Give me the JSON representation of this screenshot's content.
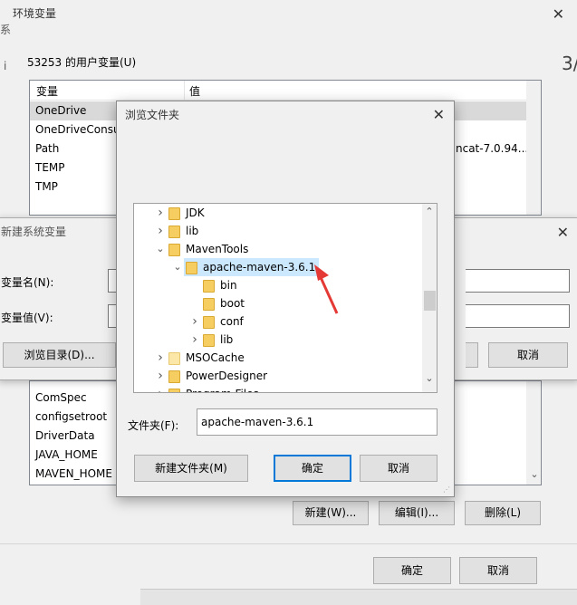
{
  "env_window": {
    "title": "环境变量",
    "user_vars_label": "53253 的用户变量(U)",
    "col_variable": "变量",
    "col_value": "值",
    "user_vars": [
      {
        "name": "OneDrive",
        "value": ""
      },
      {
        "name": "OneDriveConsu",
        "value": ""
      },
      {
        "name": "Path",
        "value": "ncat-7.0.94..."
      },
      {
        "name": "TEMP",
        "value": ""
      },
      {
        "name": "TMP",
        "value": ""
      }
    ],
    "system_vars": [
      "ComSpec",
      "configsetroot",
      "DriverData",
      "JAVA_HOME",
      "MAVEN_HOME"
    ],
    "new_button": "新建(W)...",
    "edit_button": "编辑(I)...",
    "delete_button": "删除(L)",
    "ok_button": "确定",
    "cancel_button": "取消",
    "edge_text_left": "系",
    "edge_text_i": "i",
    "edge_text_right": "3/"
  },
  "new_var_dialog": {
    "title": "新建系统变量",
    "name_label": "变量名(N):",
    "value_label": "变量值(V):",
    "browse_dir_button": "浏览目录(D)...",
    "cancel_button": "取消"
  },
  "browse_dialog": {
    "title": "浏览文件夹",
    "tree": [
      {
        "label": "JDK",
        "level": 0,
        "expander": "collapsed"
      },
      {
        "label": "lib",
        "level": 0,
        "expander": "collapsed"
      },
      {
        "label": "MavenTools",
        "level": 0,
        "expander": "expanded"
      },
      {
        "label": "apache-maven-3.6.1",
        "level": 1,
        "expander": "expanded",
        "selected": true
      },
      {
        "label": "bin",
        "level": 2,
        "expander": "none"
      },
      {
        "label": "boot",
        "level": 2,
        "expander": "none"
      },
      {
        "label": "conf",
        "level": 2,
        "expander": "collapsed"
      },
      {
        "label": "lib",
        "level": 2,
        "expander": "collapsed"
      },
      {
        "label": "MSOCache",
        "level": 0,
        "expander": "collapsed",
        "light": true
      },
      {
        "label": "PowerDesigner",
        "level": 0,
        "expander": "collapsed"
      },
      {
        "label": "Program Files",
        "level": 0,
        "expander": "collapsed"
      }
    ],
    "folder_label": "文件夹(F):",
    "folder_value": "apache-maven-3.6.1",
    "new_folder_button": "新建文件夹(M)",
    "ok_button": "确定",
    "cancel_button": "取消"
  },
  "colors": {
    "selection": "#cce8ff",
    "annotation_arrow": "#e53935"
  }
}
